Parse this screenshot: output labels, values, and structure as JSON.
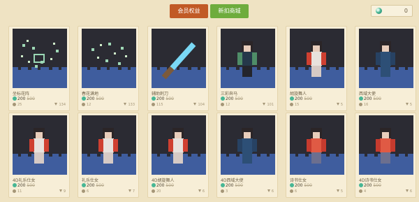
{
  "tabs": [
    {
      "label": "会员权益",
      "color": "#c15a25"
    },
    {
      "label": "新扣商城",
      "color": "#6eac3d"
    }
  ],
  "coins": {
    "count": "0",
    "icon": "coin-icon"
  },
  "items": [
    {
      "name": "坐标花阵",
      "price": "200",
      "old_price": "500",
      "likes": "25",
      "downloads": "134",
      "art": "sparkle"
    },
    {
      "name": "春花满地",
      "price": "200",
      "old_price": "500",
      "likes": "12",
      "downloads": "133",
      "art": "sparkle2"
    },
    {
      "name": "辅助刺刀",
      "price": "200",
      "old_price": "500",
      "likes": "115",
      "downloads": "104",
      "art": "sword"
    },
    {
      "name": "三彩奔马",
      "price": "200",
      "old_price": "500",
      "likes": "12",
      "downloads": "101",
      "art": "dark"
    },
    {
      "name": "胡旋舞人",
      "price": "200",
      "old_price": "500",
      "likes": "15",
      "downloads": "5",
      "art": "white"
    },
    {
      "name": "西域大使",
      "price": "200",
      "old_price": "500",
      "likes": "16",
      "downloads": "5",
      "art": "blue"
    },
    {
      "name": "4D礼乐仕女",
      "price": "200",
      "old_price": "500",
      "likes": "11",
      "downloads": "9",
      "art": "white"
    },
    {
      "name": "礼乐仕女",
      "price": "200",
      "old_price": "500",
      "likes": "6",
      "downloads": "7",
      "art": "white"
    },
    {
      "name": "4D胡旋舞人",
      "price": "200",
      "old_price": "500",
      "likes": "20",
      "downloads": "6",
      "art": "white"
    },
    {
      "name": "4D西域大使",
      "price": "200",
      "old_price": "500",
      "likes": "3",
      "downloads": "6",
      "art": "blue"
    },
    {
      "name": "诗书仕女",
      "price": "200",
      "old_price": "500",
      "likes": "6",
      "downloads": "5",
      "art": "red"
    },
    {
      "name": "4D诗书仕女",
      "price": "200",
      "old_price": "500",
      "likes": "4",
      "downloads": "6",
      "art": "red"
    }
  ]
}
